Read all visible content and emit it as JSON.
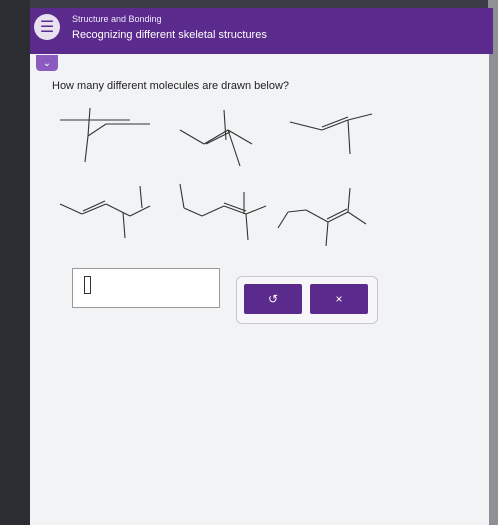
{
  "header": {
    "subtitle": "Structure and Bonding",
    "title": "Recognizing different skeletal structures",
    "menu_icon": "☰"
  },
  "collapse_icon": "⌄",
  "question": "How many different molecules are drawn below?",
  "answer": {
    "value": ""
  },
  "buttons": {
    "reset_icon": "↺",
    "close_icon": "×"
  }
}
